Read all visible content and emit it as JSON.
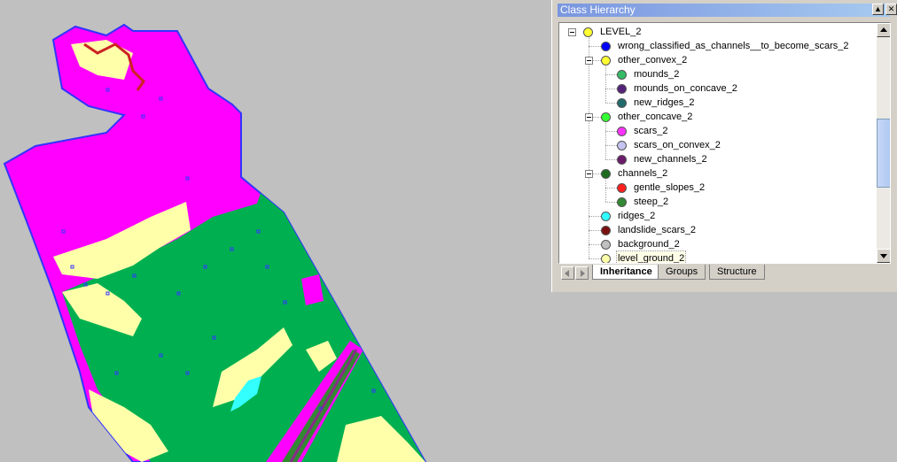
{
  "panel": {
    "title": "Class Hierarchy",
    "minimize_glyph": "▲",
    "close_glyph": "✕"
  },
  "tree": {
    "items": [
      {
        "label": "LEVEL_2",
        "color": "#ffff33",
        "depth": 0,
        "expander": true
      },
      {
        "label": "wrong_classified_as_channels__to_become_scars_2",
        "color": "#0000ff",
        "depth": 1,
        "expander": false
      },
      {
        "label": "other_convex_2",
        "color": "#ffff33",
        "depth": 1,
        "expander": true
      },
      {
        "label": "mounds_2",
        "color": "#33bb66",
        "depth": 2,
        "expander": false
      },
      {
        "label": "mounds_on_concave_2",
        "color": "#55227a",
        "depth": 2,
        "expander": false
      },
      {
        "label": "new_ridges_2",
        "color": "#226b6b",
        "depth": 2,
        "expander": false
      },
      {
        "label": "other_concave_2",
        "color": "#33ff33",
        "depth": 1,
        "expander": true
      },
      {
        "label": "scars_2",
        "color": "#ff33ff",
        "depth": 2,
        "expander": false
      },
      {
        "label": "scars_on_convex_2",
        "color": "#c4c4f0",
        "depth": 2,
        "expander": false
      },
      {
        "label": "new_channels_2",
        "color": "#6b1b6b",
        "depth": 2,
        "expander": false
      },
      {
        "label": "channels_2",
        "color": "#1f6b1f",
        "depth": 1,
        "expander": true
      },
      {
        "label": "gentle_slopes_2",
        "color": "#ff1f1f",
        "depth": 2,
        "expander": false
      },
      {
        "label": "steep_2",
        "color": "#338833",
        "depth": 2,
        "expander": false
      },
      {
        "label": "ridges_2",
        "color": "#33ffff",
        "depth": 1,
        "expander": false
      },
      {
        "label": "landslide_scars_2",
        "color": "#7a1010",
        "depth": 1,
        "expander": false
      },
      {
        "label": "background_2",
        "color": "#c0c0c0",
        "depth": 1,
        "expander": false
      },
      {
        "label": "level_ground_2",
        "color": "#ffffaa",
        "depth": 1,
        "expander": false,
        "selected": true
      }
    ]
  },
  "tabs": [
    {
      "label": "Inheritance",
      "active": true
    },
    {
      "label": "Groups",
      "active": false
    },
    {
      "label": "Structure",
      "active": false
    }
  ],
  "map": {
    "colors": {
      "background": "#c0c0c0",
      "scars": "#ff00ff",
      "mounds": "#00b050",
      "level_ground": "#ffffaa",
      "border": "#3333ff",
      "ridges": "#33ffff",
      "landslide": "#cc2222",
      "steep": "#338833",
      "new_channels": "#8a2a8a"
    }
  }
}
